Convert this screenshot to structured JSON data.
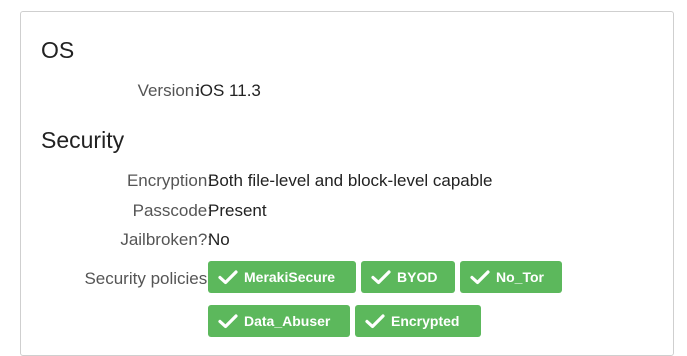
{
  "os": {
    "heading": "OS",
    "version_label": "Version:",
    "version_value": "iOS 11.3"
  },
  "security": {
    "heading": "Security",
    "encryption_label": "Encryption:",
    "encryption_value": "Both file-level and block-level capable",
    "passcode_label": "Passcode:",
    "passcode_value": "Present",
    "jailbroken_label": "Jailbroken?:",
    "jailbroken_value": "No",
    "policies_label": "Security policies:",
    "policies": [
      {
        "label": "MerakiSecure",
        "icon": "check-icon"
      },
      {
        "label": "BYOD",
        "icon": "check-icon"
      },
      {
        "label": "No_Tor",
        "icon": "check-icon"
      },
      {
        "label": "Data_Abuser",
        "icon": "check-icon"
      },
      {
        "label": "Encrypted",
        "icon": "check-icon"
      }
    ]
  },
  "colors": {
    "badge_green": "#5cb85c",
    "label_gray": "#555555",
    "border": "#cfcfcf"
  }
}
